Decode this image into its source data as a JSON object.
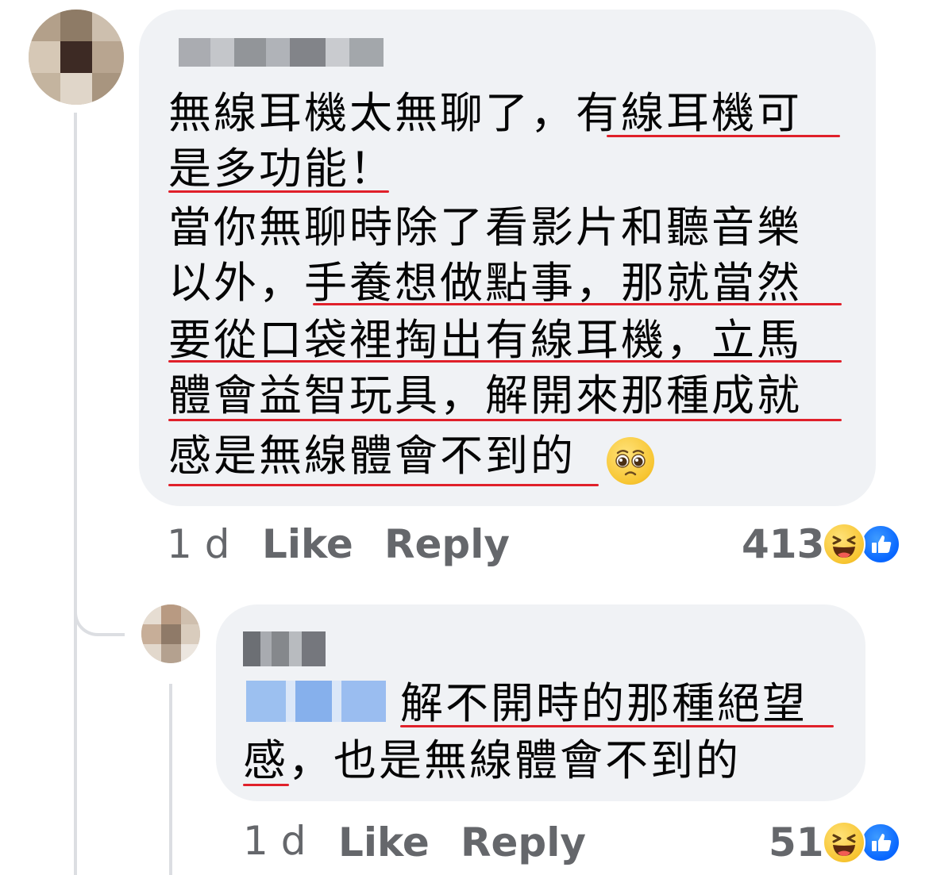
{
  "comment": {
    "lines": [
      "無線耳機太無聊了，有線耳機可",
      "是多功能！",
      "當你無聊時除了看影片和聽音樂",
      "以外，手養想做點事，那就當然",
      "要從口袋裡掏出有線耳機，立馬",
      "體會益智玩具，解開來那種成就",
      "感是無線體會不到的"
    ],
    "emoji": "pleading-face-emoji",
    "time": "1 d",
    "like_label": "Like",
    "reply_label": "Reply",
    "reaction_count": "413",
    "reactions": [
      "haha-icon",
      "like-icon"
    ]
  },
  "reply": {
    "lines": [
      "解不開時的那種絕望",
      "感，也是無線體會不到的"
    ],
    "time": "1 d",
    "like_label": "Like",
    "reply_label": "Reply",
    "reaction_count": "51",
    "reactions": [
      "haha-icon",
      "like-icon"
    ]
  },
  "colors": {
    "bubble": "#f0f2f5",
    "underline": "#e0202a",
    "meta": "#65676b",
    "like_blue": "#0866ff"
  }
}
